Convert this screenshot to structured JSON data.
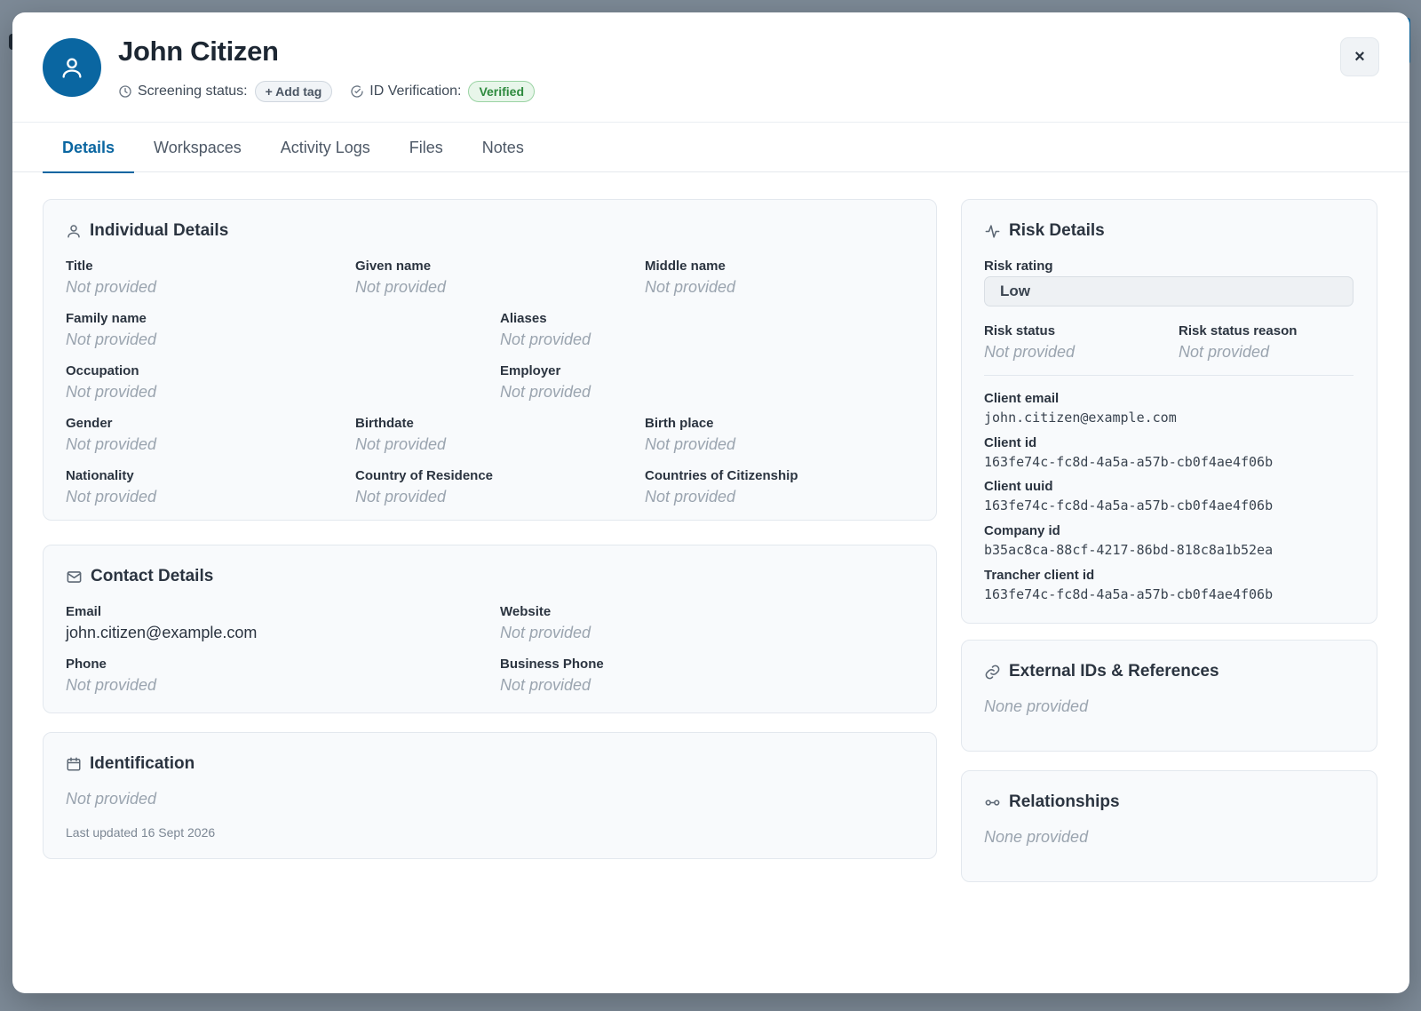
{
  "header": {
    "name": "John Citizen",
    "screening_label": "Screening status:",
    "add_tag_label": "+ Add tag",
    "id_verification_label": "ID Verification:",
    "verified_badge": "Verified",
    "close_glyph": "×"
  },
  "tabs": [
    {
      "label": "Details",
      "active": true
    },
    {
      "label": "Workspaces",
      "active": false
    },
    {
      "label": "Activity Logs",
      "active": false
    },
    {
      "label": "Files",
      "active": false
    },
    {
      "label": "Notes",
      "active": false
    }
  ],
  "individual": {
    "title": "Individual Details",
    "fields": {
      "title": {
        "label": "Title",
        "value": "Not provided"
      },
      "given_name": {
        "label": "Given name",
        "value": "Not provided"
      },
      "middle_name": {
        "label": "Middle name",
        "value": "Not provided"
      },
      "family_name": {
        "label": "Family name",
        "value": "Not provided"
      },
      "aliases": {
        "label": "Aliases",
        "value": "Not provided"
      },
      "occupation": {
        "label": "Occupation",
        "value": "Not provided"
      },
      "employer": {
        "label": "Employer",
        "value": "Not provided"
      },
      "gender": {
        "label": "Gender",
        "value": "Not provided"
      },
      "birthdate": {
        "label": "Birthdate",
        "value": "Not provided"
      },
      "birth_place": {
        "label": "Birth place",
        "value": "Not provided"
      },
      "nationality": {
        "label": "Nationality",
        "value": "Not provided"
      },
      "country_of_residence": {
        "label": "Country of Residence",
        "value": "Not provided"
      },
      "countries_of_citizenship": {
        "label": "Countries of Citizenship",
        "value": "Not provided"
      }
    }
  },
  "contact": {
    "title": "Contact Details",
    "fields": {
      "email": {
        "label": "Email",
        "value": "john.citizen@example.com"
      },
      "website": {
        "label": "Website",
        "value": "Not provided"
      },
      "phone": {
        "label": "Phone",
        "value": "Not provided"
      },
      "business_phone": {
        "label": "Business Phone",
        "value": "Not provided"
      }
    }
  },
  "identification": {
    "title": "Identification",
    "value": "Not provided",
    "last_updated": "Last updated 16 Sept 2026"
  },
  "risk": {
    "title": "Risk Details",
    "rating_label": "Risk rating",
    "rating_value": "Low",
    "status_label": "Risk status",
    "status_value": "Not provided",
    "status_reason_label": "Risk status reason",
    "status_reason_value": "Not provided",
    "ids": {
      "client_email": {
        "label": "Client email",
        "value": "john.citizen@example.com"
      },
      "client_id": {
        "label": "Client id",
        "value": "163fe74c-fc8d-4a5a-a57b-cb0f4ae4f06b"
      },
      "client_uuid": {
        "label": "Client uuid",
        "value": "163fe74c-fc8d-4a5a-a57b-cb0f4ae4f06b"
      },
      "company_id": {
        "label": "Company id",
        "value": "b35ac8ca-88cf-4217-86bd-818c8a1b52ea"
      },
      "trancher_client_id": {
        "label": "Trancher client id",
        "value": "163fe74c-fc8d-4a5a-a57b-cb0f4ae4f06b"
      }
    }
  },
  "external_ids": {
    "title": "External IDs & References",
    "value": "None provided"
  },
  "relationships": {
    "title": "Relationships",
    "value": "None provided"
  },
  "colors": {
    "accent": "#0a66a1",
    "verified_green": "#2e8a3e",
    "placeholder_gray": "#9aa4af"
  },
  "icons": {
    "avatar": "user-icon",
    "screening": "clock-icon",
    "id_verification": "check-circle-icon",
    "close": "close-icon",
    "individual": "user-icon",
    "contact": "mail-icon",
    "identification": "calendar-icon",
    "risk": "activity-icon",
    "external": "link-icon",
    "relationships": "relationship-icon"
  }
}
